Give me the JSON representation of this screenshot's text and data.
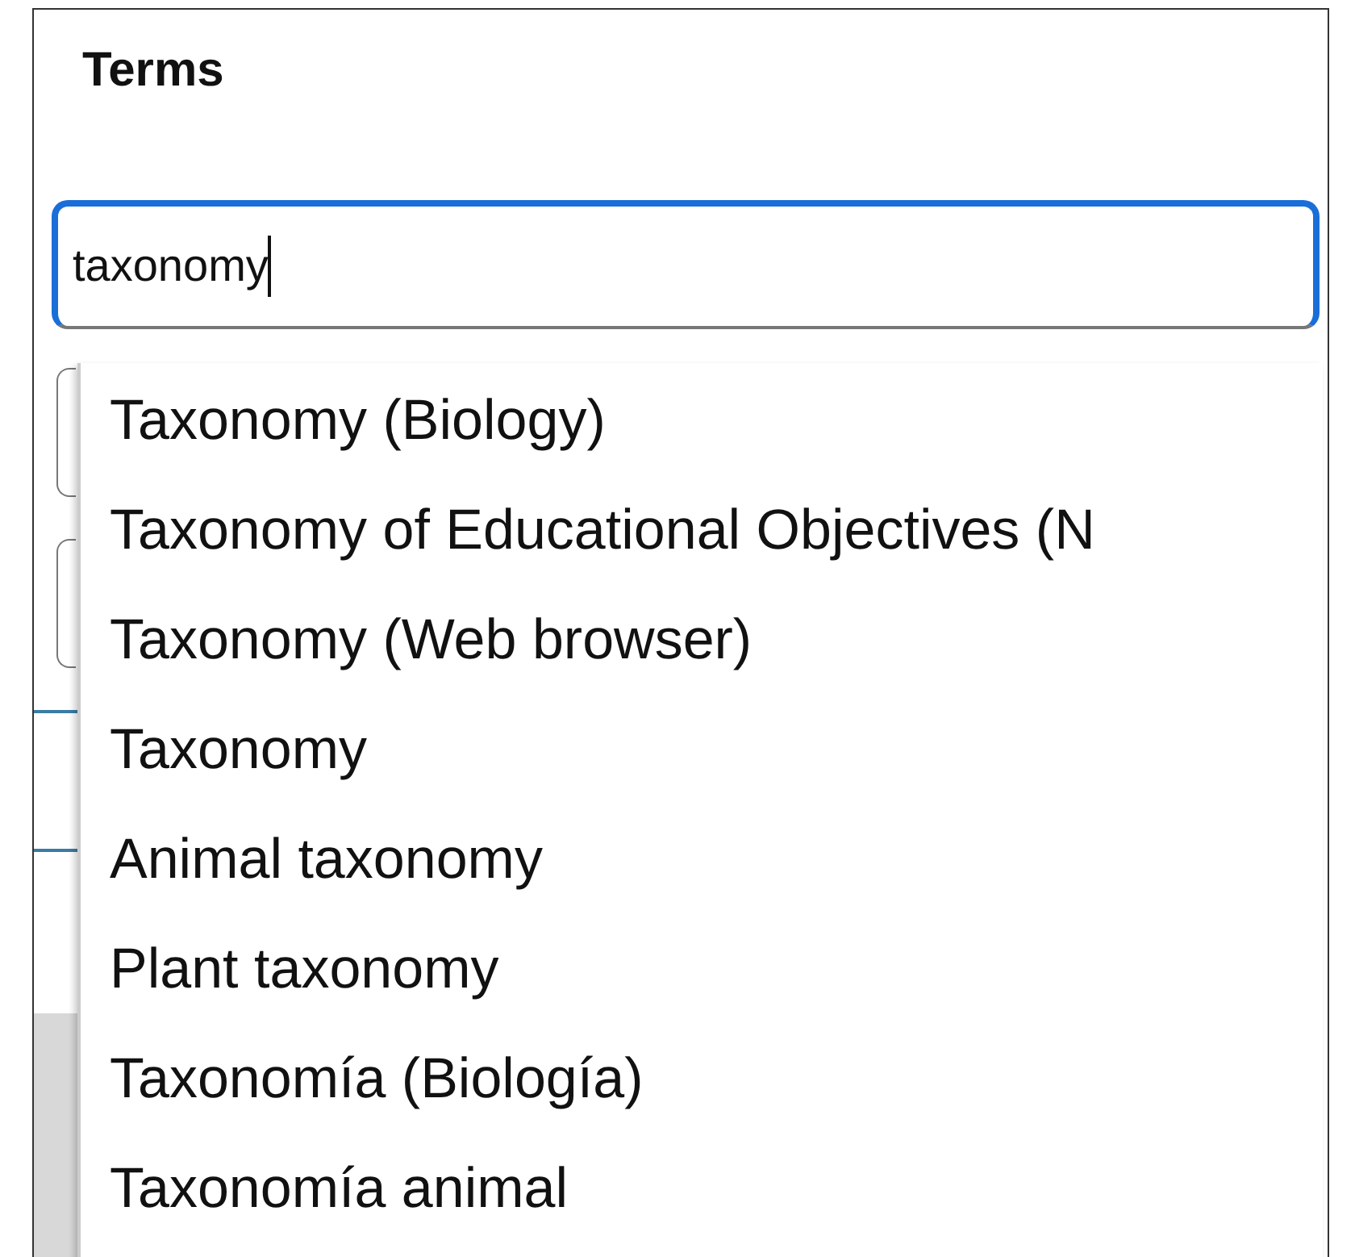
{
  "panel": {
    "title": "Terms"
  },
  "search": {
    "value": "taxonomy",
    "focused": true
  },
  "suggestions": [
    {
      "label": "Taxonomy (Biology)"
    },
    {
      "label": "Taxonomy of Educational Objectives (N"
    },
    {
      "label": "Taxonomy (Web browser)"
    },
    {
      "label": "Taxonomy"
    },
    {
      "label": "Animal taxonomy"
    },
    {
      "label": "Plant taxonomy"
    },
    {
      "label": "Taxonomía (Biología)"
    },
    {
      "label": "Taxonomía animal"
    }
  ]
}
